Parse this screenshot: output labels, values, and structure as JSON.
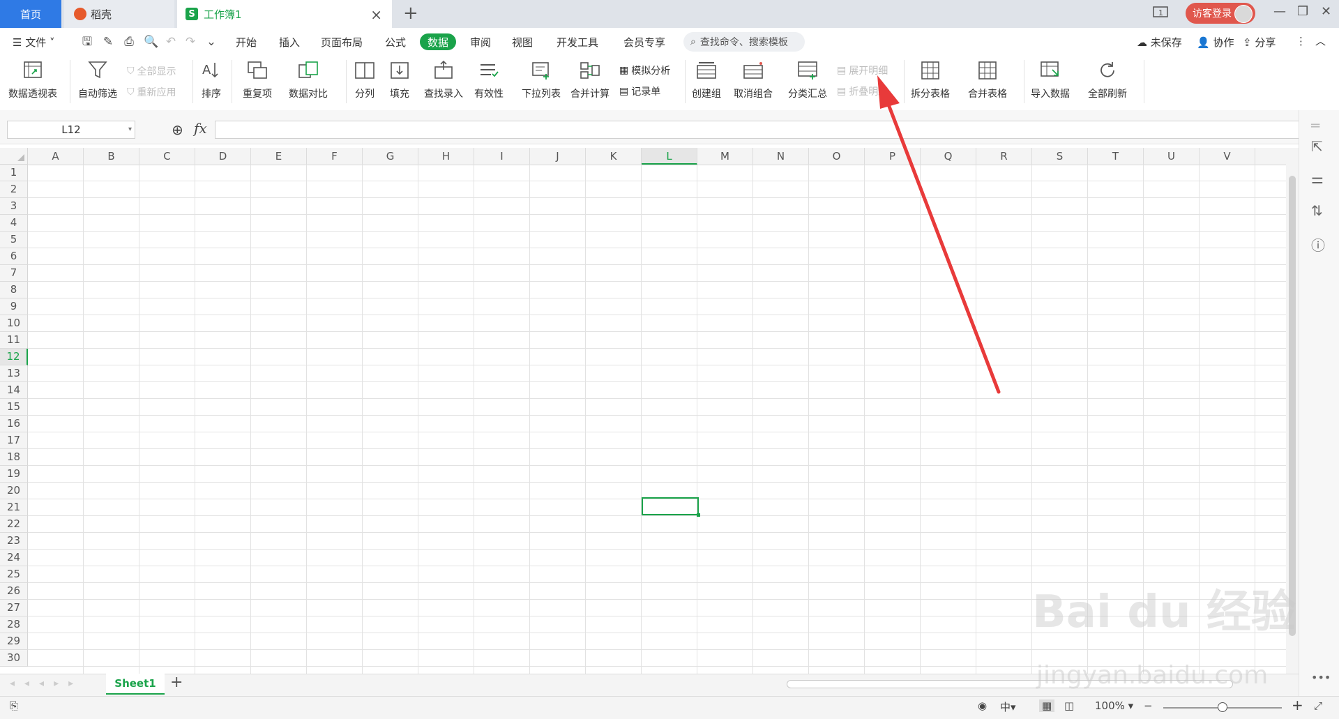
{
  "titlebar": {
    "tabs": [
      "首页",
      "稻壳",
      "工作簿1"
    ],
    "login": "访客登录"
  },
  "menubar": {
    "file": "文件",
    "items": [
      "开始",
      "插入",
      "页面布局",
      "公式",
      "数据",
      "审阅",
      "视图",
      "开发工具",
      "会员专享"
    ],
    "active": "数据",
    "search_placeholder": "查找命令、搜索模板",
    "right": [
      "未保存",
      "协作",
      "分享"
    ]
  },
  "ribbon": {
    "pivot": "数据透视表",
    "autofilter": "自动筛选",
    "show_all": "全部显示",
    "reapply": "重新应用",
    "sort": "排序",
    "duplicates": "重复项",
    "compare": "数据对比",
    "split": "分列",
    "fill": "填充",
    "lookup": "查找录入",
    "validity": "有效性",
    "dropdown": "下拉列表",
    "consolidate": "合并计算",
    "whatif": "模拟分析",
    "record": "记录单",
    "group": "创建组",
    "ungroup": "取消组合",
    "subtotal": "分类汇总",
    "expand": "展开明细",
    "collapse": "折叠明细",
    "split_table": "拆分表格",
    "merge_table": "合并表格",
    "import": "导入数据",
    "refresh": "全部刷新"
  },
  "formula": {
    "namebox": "L12",
    "fx": "fx",
    "value": ""
  },
  "grid": {
    "columns": [
      "A",
      "B",
      "C",
      "D",
      "E",
      "F",
      "G",
      "H",
      "I",
      "J",
      "K",
      "L",
      "M",
      "N",
      "O",
      "P",
      "Q",
      "R",
      "S",
      "T",
      "U",
      "V"
    ],
    "rows": [
      "1",
      "2",
      "3",
      "4",
      "5",
      "6",
      "7",
      "8",
      "9",
      "10",
      "11",
      "12",
      "13",
      "14",
      "15",
      "16",
      "17",
      "18",
      "19",
      "20",
      "21",
      "22",
      "23",
      "24",
      "25",
      "26",
      "27",
      "28",
      "29",
      "30"
    ],
    "selected_col": "L",
    "selected_row": "12"
  },
  "sheets": {
    "tabs": [
      "Sheet1"
    ],
    "active": "Sheet1"
  },
  "status": {
    "zoom": "100%"
  },
  "watermark": {
    "brand": "Bai du 经验",
    "url": "jingyan.baidu.com"
  },
  "colors": {
    "accent": "#1aa34a",
    "home_tab": "#2f7ae5",
    "login": "#e0574d",
    "annotation": "#e83a3a"
  }
}
